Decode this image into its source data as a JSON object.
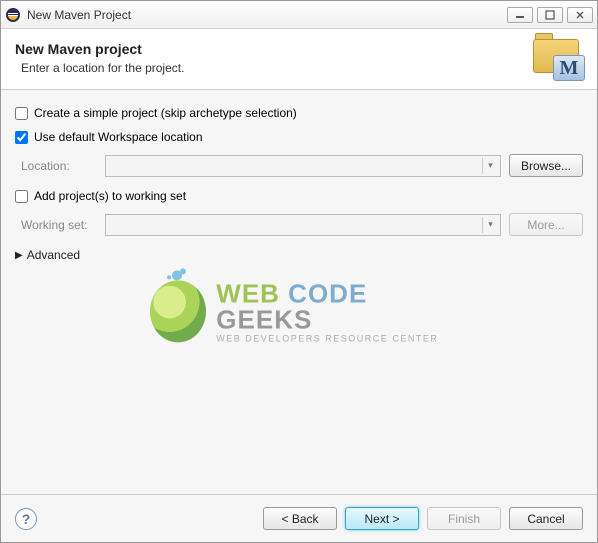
{
  "window": {
    "title": "New Maven Project"
  },
  "banner": {
    "title": "New Maven project",
    "subtitle": "Enter a location for the project.",
    "badge_letter": "M"
  },
  "form": {
    "simple_project_label": "Create a simple project (skip archetype selection)",
    "simple_project_checked": false,
    "use_default_label": "Use default Workspace location",
    "use_default_checked": true,
    "location_label": "Location:",
    "location_value": "",
    "browse_label": "Browse...",
    "add_working_set_label": "Add project(s) to working set",
    "add_working_set_checked": false,
    "working_set_label": "Working set:",
    "working_set_value": "",
    "more_label": "More...",
    "advanced_label": "Advanced"
  },
  "watermark": {
    "line1_a": "WEB ",
    "line1_b": "CODE ",
    "line1_c": "GEEKS",
    "line2": "WEB DEVELOPERS RESOURCE CENTER"
  },
  "footer": {
    "back": "< Back",
    "next": "Next >",
    "finish": "Finish",
    "cancel": "Cancel"
  }
}
